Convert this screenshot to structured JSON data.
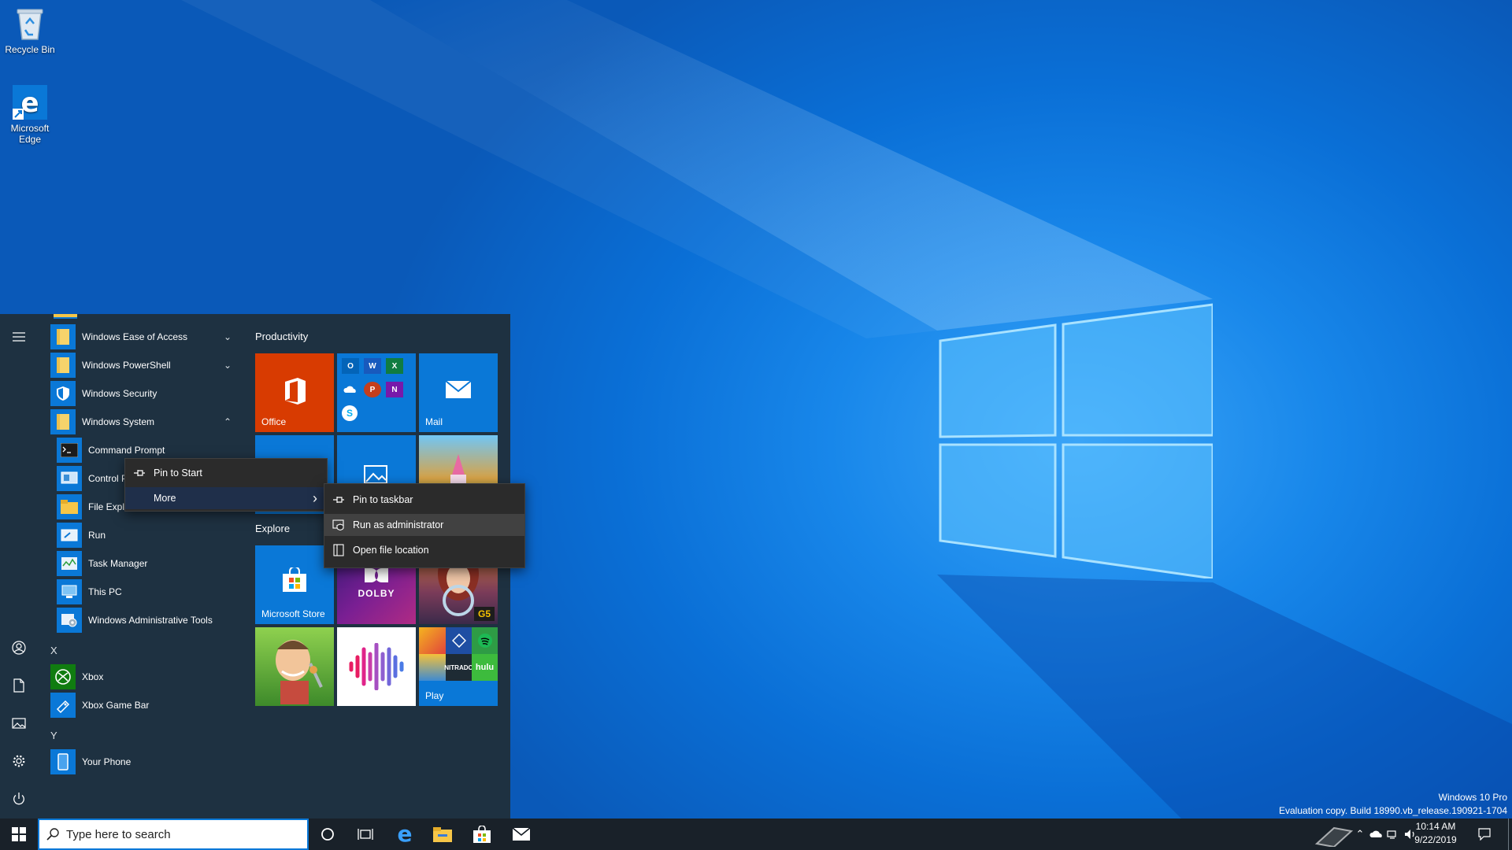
{
  "desktop": {
    "icons": [
      {
        "label": "Recycle Bin"
      },
      {
        "label": "Microsoft\nEdge"
      }
    ],
    "watermark": {
      "edition": "Windows 10 Pro",
      "build": "Evaluation copy. Build 18990.vb_release.190921-1704"
    }
  },
  "start_menu": {
    "apps": [
      {
        "label": "Windows Ease of Access",
        "expand": "⌄"
      },
      {
        "label": "Windows PowerShell",
        "expand": "⌄"
      },
      {
        "label": "Windows Security"
      },
      {
        "label": "Windows System",
        "expand": "⌃"
      },
      {
        "label": "Command Prompt"
      },
      {
        "label": "Control P"
      },
      {
        "label": "File Explo"
      },
      {
        "label": "Run"
      },
      {
        "label": "Task Manager"
      },
      {
        "label": "This PC"
      },
      {
        "label": "Windows Administrative Tools"
      },
      {
        "label": "Xbox"
      },
      {
        "label": "Xbox Game Bar"
      },
      {
        "label": "Your Phone"
      }
    ],
    "letters": [
      "X",
      "Y"
    ],
    "groups": {
      "productivity": "Productivity",
      "explore": "Explore"
    },
    "tiles": {
      "office": "Office",
      "mail": "Mail",
      "store": "Microsoft Store",
      "play": "Play",
      "dolby": "DOLBY",
      "hulu": "hulu",
      "nitrado": "NITRADO",
      "g5": "G5"
    }
  },
  "context_menu": {
    "items": [
      {
        "label": "Pin to Start"
      },
      {
        "label": "More",
        "arrow": "›"
      }
    ]
  },
  "submenu": {
    "items": [
      {
        "label": "Pin to taskbar"
      },
      {
        "label": "Run as administrator"
      },
      {
        "label": "Open file location"
      }
    ]
  },
  "taskbar": {
    "search_placeholder": "Type here to search",
    "time": "10:14 AM",
    "date": "9/22/2019"
  },
  "colors": {
    "accent": "#0078d7",
    "office": "#d83b01",
    "menu_bg": "#2b2b2b",
    "start_bg": "#1f303d"
  }
}
